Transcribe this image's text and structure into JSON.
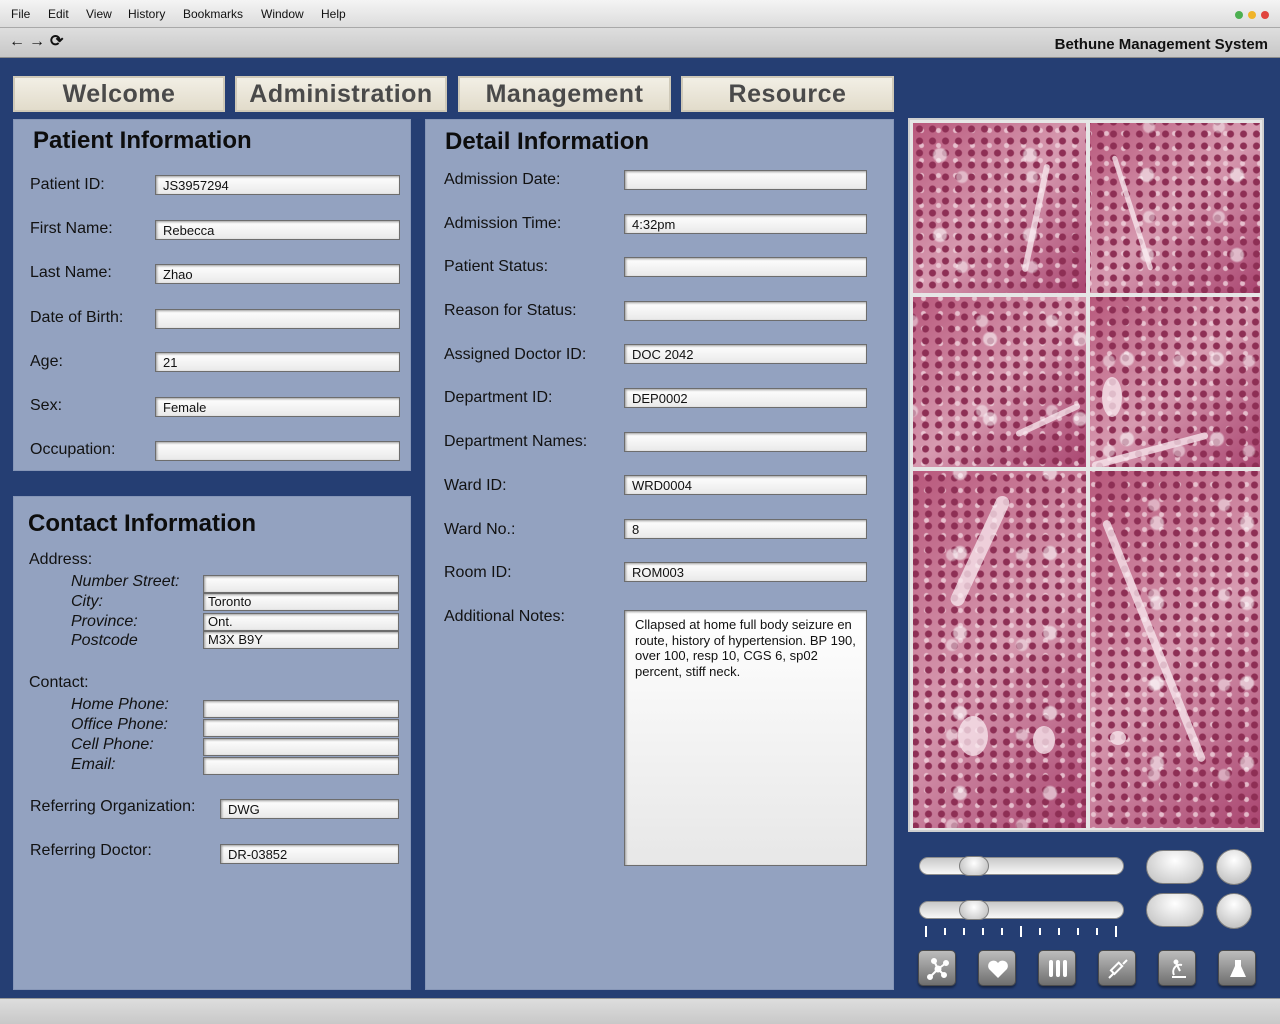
{
  "menubar": {
    "items": [
      "File",
      "Edit",
      "View",
      "History",
      "Bookmarks",
      "Window",
      "Help"
    ],
    "traffic_colors": [
      "#4caf50",
      "#f0b429",
      "#e0443e"
    ]
  },
  "toolbar": {
    "back_icon": "←",
    "forward_icon": "→",
    "reload_icon": "⟳",
    "title": "Bethune Management System"
  },
  "tabs": [
    "Welcome",
    "Administration",
    "Management",
    "Resource"
  ],
  "patient": {
    "title": "Patient Information",
    "fields": [
      {
        "label": "Patient ID:",
        "value": "JS3957294"
      },
      {
        "label": "First Name:",
        "value": "Rebecca"
      },
      {
        "label": "Last Name:",
        "value": "Zhao"
      },
      {
        "label": "Date of Birth:",
        "value": ""
      },
      {
        "label": "Age:",
        "value": "21"
      },
      {
        "label": "Sex:",
        "value": "Female"
      },
      {
        "label": "Occupation:",
        "value": ""
      }
    ]
  },
  "contact": {
    "title": "Contact Information",
    "address_label": "Address:",
    "address": [
      {
        "label": "Number Street:",
        "value": ""
      },
      {
        "label": "City:",
        "value": "Toronto"
      },
      {
        "label": "Province:",
        "value": "Ont."
      },
      {
        "label": "Postcode",
        "value": "M3X B9Y"
      }
    ],
    "contact_label": "Contact:",
    "contacts": [
      {
        "label": "Home Phone:",
        "value": ""
      },
      {
        "label": "Office Phone:",
        "value": ""
      },
      {
        "label": "Cell Phone:",
        "value": ""
      },
      {
        "label": "Email:",
        "value": ""
      }
    ],
    "referring_org_label": "Referring Organization:",
    "referring_org": "DWG",
    "referring_doctor_label": "Referring Doctor:",
    "referring_doctor": "DR-03852"
  },
  "detail": {
    "title": "Detail Information",
    "fields": [
      {
        "label": "Admission Date:",
        "value": ""
      },
      {
        "label": "Admission Time:",
        "value": "4:32pm"
      },
      {
        "label": "Patient Status:",
        "value": ""
      },
      {
        "label": "Reason for Status:",
        "value": ""
      },
      {
        "label": "Assigned Doctor ID:",
        "value": "DOC 2042"
      },
      {
        "label": "Department ID:",
        "value": "DEP0002"
      },
      {
        "label": "Department Names:",
        "value": ""
      },
      {
        "label": "Ward ID:",
        "value": "WRD0004"
      },
      {
        "label": "Ward No.:",
        "value": "8"
      },
      {
        "label": "Room ID:",
        "value": "ROM003"
      }
    ],
    "notes_label": "Additional Notes:",
    "notes": "Cllapsed at home full body seizure en route, history of hypertension. BP 190, over 100, resp 10, CGS 6, sp02 percent, stiff neck."
  },
  "controls": {
    "slider1_level": 0.22,
    "slider2_level": 0.22,
    "tools": [
      "molecule-icon",
      "heart-icon",
      "test-tubes-icon",
      "syringe-icon",
      "microscope-icon",
      "flask-icon"
    ]
  },
  "colors": {
    "background": "#253e73",
    "panel": "#93a2c0",
    "tab": "#ece7d9"
  }
}
